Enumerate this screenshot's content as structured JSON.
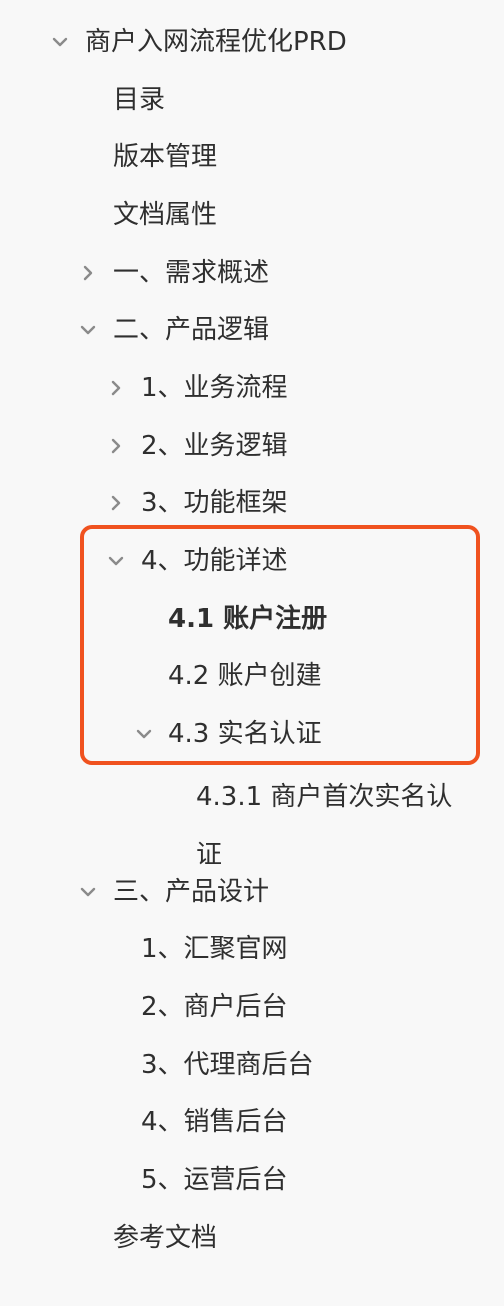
{
  "tree": {
    "root": "商户入网流程优化PRD",
    "toc": "目录",
    "version": "版本管理",
    "props": "文档属性",
    "s1": "一、需求概述",
    "s2": "二、产品逻辑",
    "s2_1": "1、业务流程",
    "s2_2": "2、业务逻辑",
    "s2_3": "3、功能框架",
    "s2_4": "4、功能详述",
    "s2_4_1": "4.1 账户注册",
    "s2_4_2": "4.2 账户创建",
    "s2_4_3": "4.3 实名认证",
    "s2_4_3_1": "4.3.1 商户首次实名认证",
    "s3": "三、产品设计",
    "s3_1": "1、汇聚官网",
    "s3_2": "2、商户后台",
    "s3_3": "3、代理商后台",
    "s3_4": "4、销售后台",
    "s3_5": "5、运营后台",
    "ref": "参考文档"
  },
  "colors": {
    "highlight_border": "#f0521f",
    "chevron": "#8a8a8a",
    "text": "#2f2f2f",
    "background": "#f8f8f8"
  },
  "icons": {
    "expanded": "chevron-down-icon",
    "collapsed": "chevron-right-icon"
  }
}
